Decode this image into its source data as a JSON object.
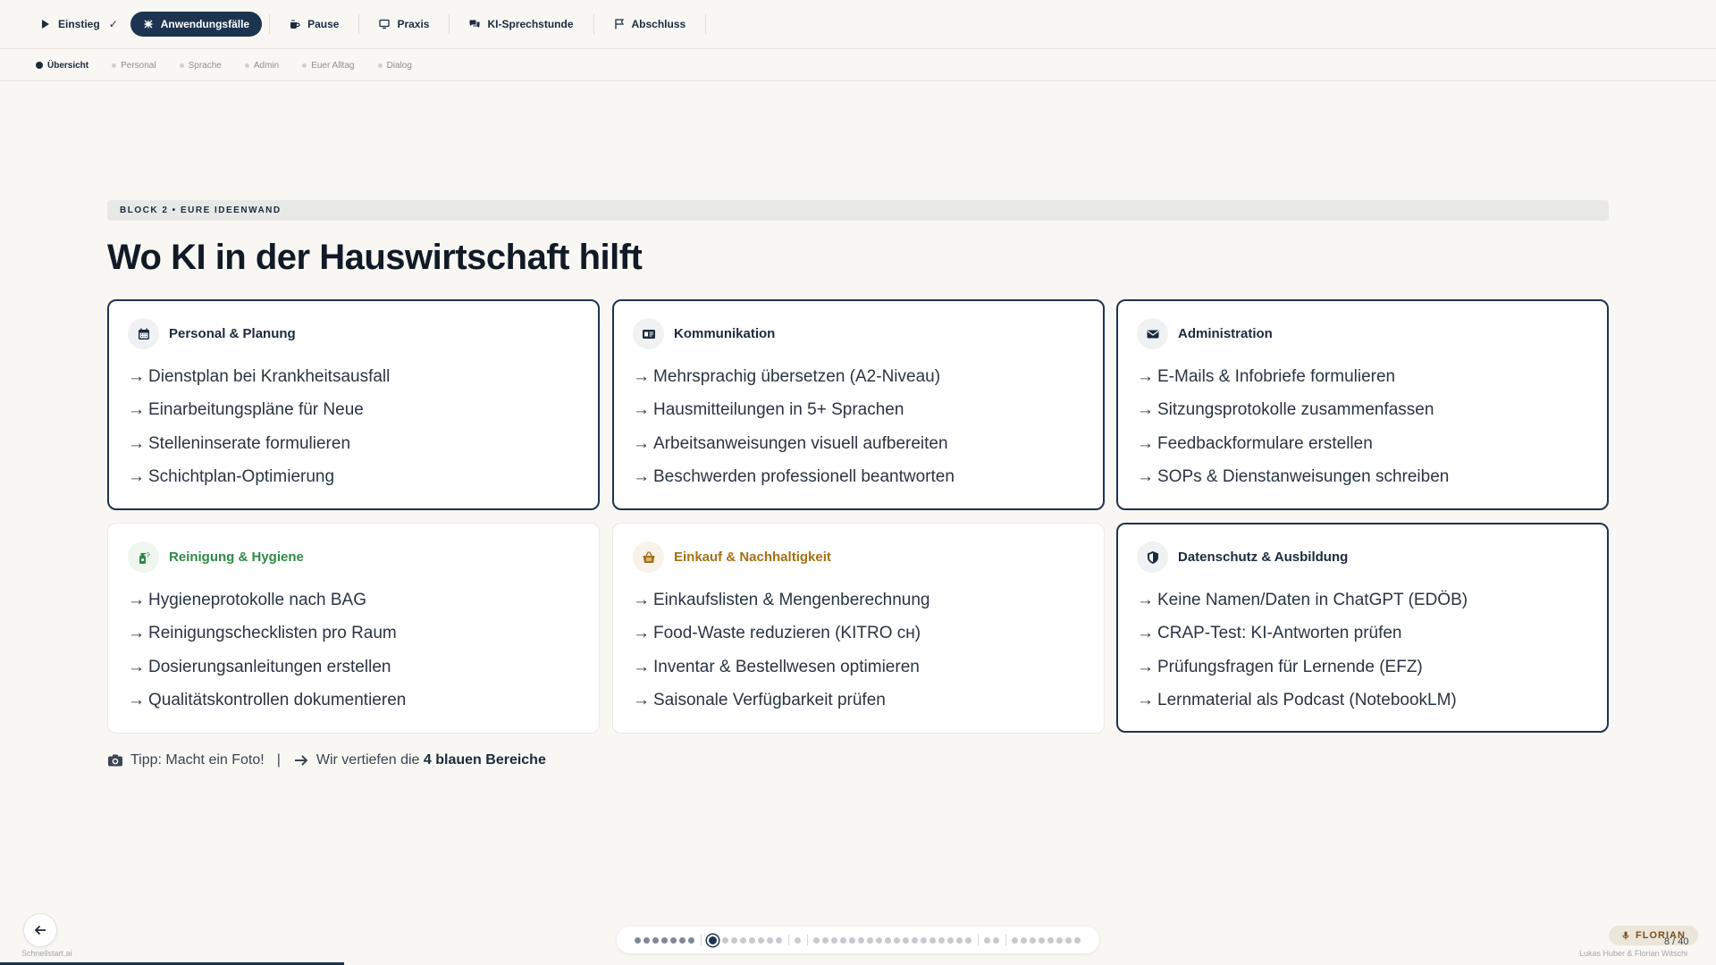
{
  "topnav": {
    "items": [
      {
        "label": "Einstieg",
        "icon": "play-icon",
        "checked": true
      },
      {
        "label": "Anwendungsfälle",
        "icon": "sparkle-icon",
        "active": true
      },
      {
        "label": "Pause",
        "icon": "coffee-icon"
      },
      {
        "label": "Praxis",
        "icon": "monitor-icon"
      },
      {
        "label": "KI-Sprechstunde",
        "icon": "chat-icon"
      },
      {
        "label": "Abschluss",
        "icon": "flag-icon"
      }
    ],
    "check_glyph": "✓"
  },
  "subnav": {
    "items": [
      "Übersicht",
      "Personal",
      "Sprache",
      "Admin",
      "Euer Alltag",
      "Dialog"
    ],
    "active_index": 0
  },
  "block_label": "BLOCK 2 • EURE IDEENWAND",
  "title": "Wo KI in der Hauswirtschaft hilft",
  "arrow_glyph": "→",
  "cards": [
    {
      "title": "Personal & Planung",
      "icon": "calendar-icon",
      "highlight": true,
      "items": [
        "Dienstplan bei Krankheitsausfall",
        "Einarbeitungspläne für Neue",
        "Stelleninserate formulieren",
        "Schichtplan-Optimierung"
      ]
    },
    {
      "title": "Kommunikation",
      "icon": "id-card-icon",
      "highlight": true,
      "items": [
        "Mehrsprachig übersetzen (A2-Niveau)",
        "Hausmitteilungen in 5+ Sprachen",
        "Arbeitsanweisungen visuell aufbereiten",
        "Beschwerden professionell beantworten"
      ]
    },
    {
      "title": "Administration",
      "icon": "envelope-icon",
      "highlight": true,
      "items": [
        "E-Mails & Infobriefe formulieren",
        "Sitzungsprotokolle zusammenfassen",
        "Feedbackformulare erstellen",
        "SOPs & Dienstanweisungen schreiben"
      ]
    },
    {
      "title": "Reinigung & Hygiene",
      "icon": "spray-bottle-icon",
      "highlight": false,
      "color": "#2e8a45",
      "items": [
        "Hygieneprotokolle nach BAG",
        "Reinigungschecklisten pro Raum",
        "Dosierungsanleitungen erstellen",
        "Qualitätskontrollen dokumentieren"
      ]
    },
    {
      "title": "Einkauf & Nachhaltigkeit",
      "icon": "basket-icon",
      "highlight": false,
      "color": "#a87015",
      "items": [
        "Einkaufslisten & Mengenberechnung",
        "Food-Waste reduzieren (KITRO ᴄʜ)",
        "Inventar & Bestellwesen optimieren",
        "Saisonale Verfügbarkeit prüfen"
      ]
    },
    {
      "title": "Datenschutz & Ausbildung",
      "icon": "shield-icon",
      "highlight": true,
      "items": [
        "Keine Namen/Daten in ChatGPT (EDÖB)",
        "CRAP-Test: KI-Antworten prüfen",
        "Prüfungsfragen für Lernende (EFZ)",
        "Lernmaterial als Podcast (NotebookLM)"
      ]
    }
  ],
  "tip": {
    "photo": "Tipp: Macht ein Foto!",
    "separator": "|",
    "deepen_prefix": "Wir vertiefen die",
    "deepen_bold": "4 blauen Bereiche"
  },
  "footer": {
    "brand": "Schnellstart.ai",
    "speaker": "FLORIAN",
    "slide_counter": "8 / 40",
    "authors": "Lukas Huber & Florian Witschi"
  },
  "colors": {
    "accent": "#1d3450",
    "background": "#f8f7f3",
    "green": "#2e8a45",
    "amber": "#a87015",
    "speaker_bg": "#ece5da"
  },
  "progress": {
    "current": 8,
    "total": 40,
    "groups": [
      7,
      8,
      1,
      18,
      2,
      8
    ]
  }
}
